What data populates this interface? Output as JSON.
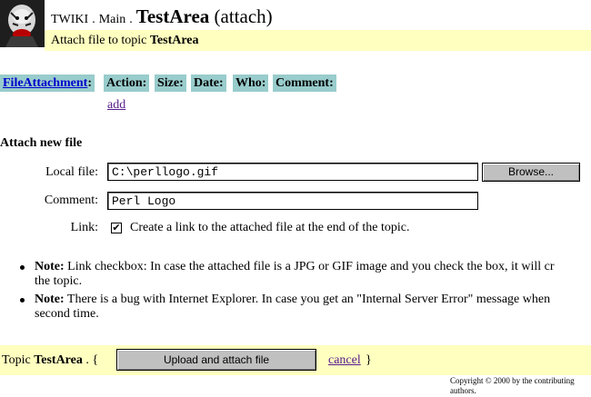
{
  "header": {
    "web": "TWIKI",
    "sep": ".",
    "main": "Main",
    "topic": "TestArea",
    "mode": "(attach)",
    "subtitle_prefix": "Attach file to topic",
    "subtitle_topic": "TestArea"
  },
  "attachments_table": {
    "headers": [
      "FileAttachment",
      "Action:",
      "Size:",
      "Date:",
      "Who:",
      "Comment:"
    ],
    "first_header_colon": ":",
    "add_link": "add"
  },
  "form": {
    "section_title": "Attach new file",
    "local_file_label": "Local file:",
    "local_file_value": "C:\\perllogo.gif",
    "browse_button": "Browse...",
    "comment_label": "Comment:",
    "comment_value": "Perl Logo",
    "link_label": "Link:",
    "link_checked": true,
    "checkbox_mark": "✔",
    "link_text": "Create a link to the attached file at the end of the topic."
  },
  "notes": [
    {
      "bold": "Note:",
      "text": " Link checkbox: In case the attached file is a JPG or GIF image and you check the box, it will cr",
      "text2": "the topic."
    },
    {
      "bold": "Note:",
      "text": " There is a bug with Internet Explorer. In case you get an \"Internal Server Error\" message when",
      "text2": "second time."
    }
  ],
  "footer": {
    "topic_label": "Topic",
    "topic_name": "TestArea",
    "dot_brace": ". {",
    "upload_button": "Upload and attach file",
    "cancel_link": "cancel",
    "close_brace": "}",
    "copyright_line1": "Copyright © 2000 by the contributing",
    "copyright_line2": "authors."
  },
  "colors": {
    "header_band": "#ffffc0",
    "table_header": "#99cccc",
    "link": "#0000cc",
    "visited_link": "#551a8b",
    "button": "#c0c0c0"
  }
}
